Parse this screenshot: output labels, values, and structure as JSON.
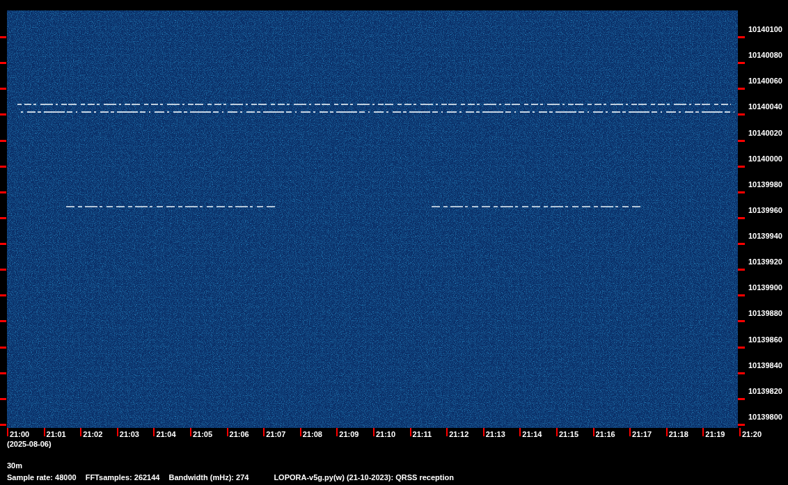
{
  "plot": {
    "frequency_labels": [
      "10140100",
      "10140080",
      "10140060",
      "10140040",
      "10140020",
      "10140000",
      "10139980",
      "10139960",
      "10139940",
      "10139920",
      "10139900",
      "10139880",
      "10139860",
      "10139840",
      "10139820",
      "10139800"
    ],
    "time_labels": [
      "21:00",
      "21:01",
      "21:02",
      "21:03",
      "21:04",
      "21:05",
      "21:06",
      "21:07",
      "21:08",
      "21:09",
      "21:10",
      "21:11",
      "21:12",
      "21:13",
      "21:14",
      "21:15",
      "21:16",
      "21:17",
      "21:18",
      "21:19",
      "21:20"
    ],
    "date": "(2025-08-06)"
  },
  "band": "30m",
  "footer": {
    "stats": [
      "Sample rate: 48000",
      "FFTsamples: 262144",
      "Bandwidth (mHz): 274"
    ],
    "program": "LOPORA-v5g.py(w) (21-10-2023): QRSS reception"
  }
}
